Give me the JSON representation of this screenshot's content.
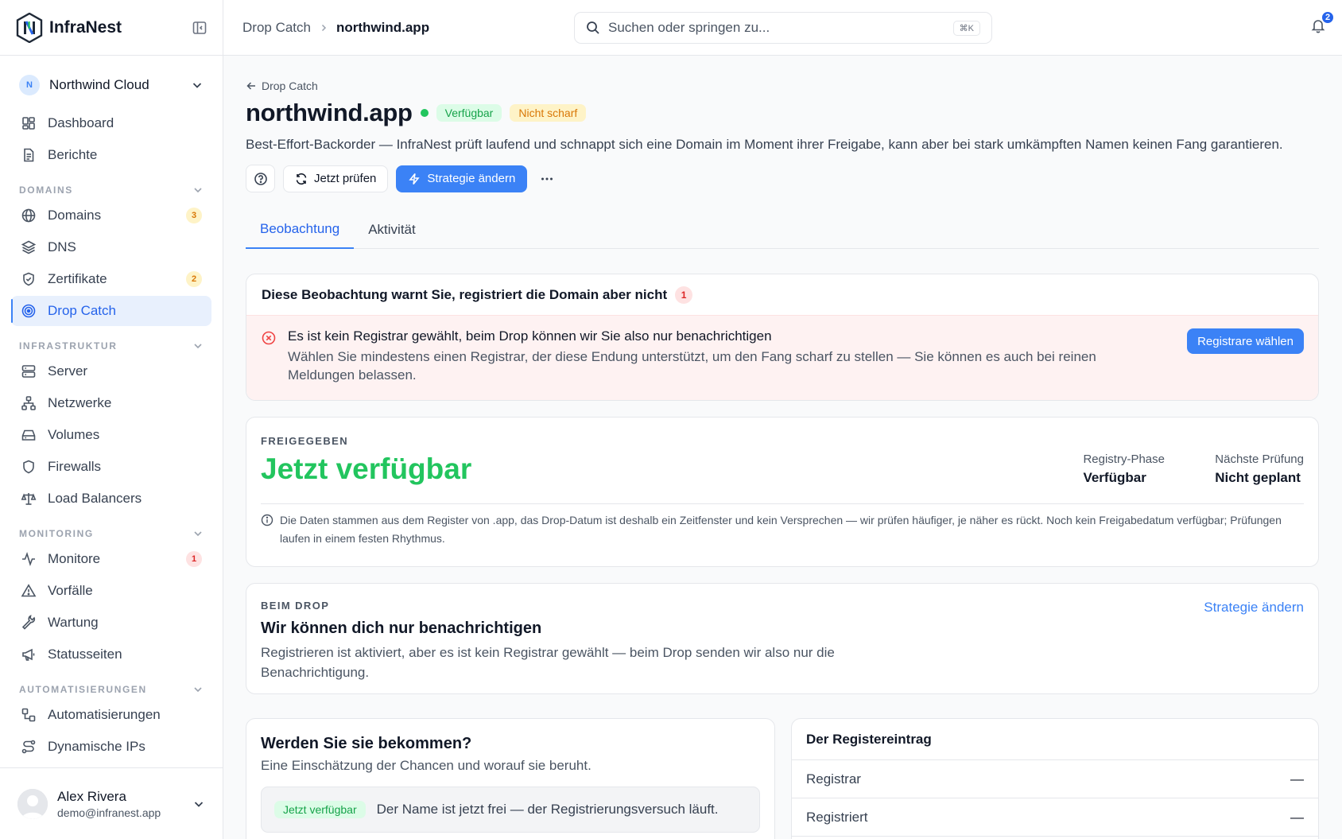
{
  "app": {
    "name": "InfraNest"
  },
  "org": {
    "initial": "N",
    "name": "Northwind Cloud"
  },
  "nav": {
    "top": [
      {
        "label": "Dashboard"
      },
      {
        "label": "Berichte"
      }
    ],
    "sections": {
      "domains": {
        "title": "DOMAINS"
      },
      "infra": {
        "title": "INFRASTRUKTUR"
      },
      "monitoring": {
        "title": "MONITORING"
      },
      "automation": {
        "title": "AUTOMATISIERUNGEN"
      }
    },
    "domains": [
      {
        "label": "Domains",
        "badge": "3"
      },
      {
        "label": "DNS"
      },
      {
        "label": "Zertifikate",
        "badge": "2"
      },
      {
        "label": "Drop Catch"
      }
    ],
    "infra": [
      {
        "label": "Server"
      },
      {
        "label": "Netzwerke"
      },
      {
        "label": "Volumes"
      },
      {
        "label": "Firewalls"
      },
      {
        "label": "Load Balancers"
      }
    ],
    "monitoring": [
      {
        "label": "Monitore",
        "badge": "1"
      },
      {
        "label": "Vorfälle"
      },
      {
        "label": "Wartung"
      },
      {
        "label": "Statusseiten"
      }
    ],
    "automation": [
      {
        "label": "Automatisierungen"
      },
      {
        "label": "Dynamische IPs"
      }
    ]
  },
  "user": {
    "name": "Alex Rivera",
    "email": "demo@infranest.app"
  },
  "topbar": {
    "breadcrumb": [
      "Drop Catch",
      "northwind.app"
    ],
    "search_placeholder": "Suchen oder springen zu...",
    "search_shortcut": "⌘K",
    "notifications": "2"
  },
  "page": {
    "back_label": "Drop Catch",
    "title": "northwind.app",
    "status_pill": "Verfügbar",
    "armed_pill": "Nicht scharf",
    "description": "Best-Effort-Backorder — InfraNest prüft laufend und schnappt sich eine Domain im Moment ihrer Freigabe, kann aber bei stark umkämpften Namen keinen Fang garantieren.",
    "actions": {
      "check": "Jetzt prüfen",
      "strategy": "Strategie ändern"
    },
    "tabs": [
      {
        "label": "Beobachtung"
      },
      {
        "label": "Aktivität"
      }
    ]
  },
  "warning": {
    "heading": "Diese Beobachtung warnt Sie, registriert die Domain aber nicht",
    "count": "1",
    "title": "Es ist kein Registrar gewählt, beim Drop können wir Sie also nur benachrichtigen",
    "text": "Wählen Sie mindestens einen Registrar, der diese Endung unterstützt, um den Fang scharf zu stellen — Sie können es auch bei reinen Meldungen belassen.",
    "button": "Registrare wählen"
  },
  "status": {
    "eyebrow": "FREIGEGEBEN",
    "headline": "Jetzt verfügbar",
    "phase_label": "Registry-Phase",
    "phase_value": "Verfügbar",
    "next_label": "Nächste Prüfung",
    "next_value": "Nicht geplant",
    "note": "Die Daten stammen aus dem Register von .app, das Drop-Datum ist deshalb ein Zeitfenster und kein Versprechen — wir prüfen häufiger, je näher es rückt. Noch kein Freigabedatum verfügbar; Prüfungen laufen in einem festen Rhythmus."
  },
  "drop": {
    "eyebrow": "BEIM DROP",
    "link": "Strategie ändern",
    "title": "Wir können dich nur benachrichtigen",
    "text": "Registrieren ist aktiviert, aber es ist kein Registrar gewählt — beim Drop senden wir also nur die Benachrichtigung."
  },
  "chances": {
    "title": "Werden Sie sie bekommen?",
    "subtitle": "Eine Einschätzung der Chancen und worauf sie beruht.",
    "pill": "Jetzt verfügbar",
    "text": "Der Name ist jetzt frei — der Registrierungsversuch läuft."
  },
  "registry": {
    "title": "Der Registereintrag",
    "rows": [
      {
        "label": "Registrar",
        "value": "—"
      },
      {
        "label": "Registriert",
        "value": "—"
      }
    ]
  }
}
